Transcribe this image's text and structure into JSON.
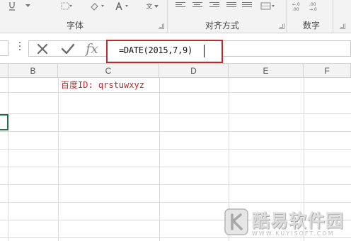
{
  "ribbon": {
    "groups": [
      {
        "label": "字体"
      },
      {
        "label": "对齐方式"
      },
      {
        "label": "数字"
      }
    ],
    "font_format_label": "文"
  },
  "formula_bar": {
    "cancel_icon": "close-icon",
    "enter_icon": "check-icon",
    "function_label": "fx",
    "formula": "=DATE(2015,7,9)"
  },
  "columns": [
    "B",
    "C",
    "D",
    "E",
    "F"
  ],
  "cells": {
    "C2": "百度ID: qrstuwxyz"
  },
  "watermark": {
    "text": "酷易软件园",
    "url": "WWW.KUYISOFT.COM"
  },
  "colors": {
    "highlight_red": "#c0282b",
    "selection_green": "#217346"
  }
}
